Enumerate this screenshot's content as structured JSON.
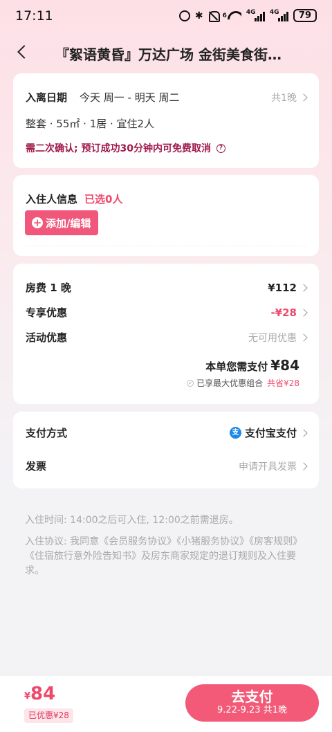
{
  "status_bar": {
    "time": "17:11",
    "battery": "79",
    "signal_label_1": "4G",
    "signal_label_2": "4G",
    "wifi_label": "6"
  },
  "header": {
    "title": "『絮语黄昏』万达广场 金街美食街…"
  },
  "stay": {
    "date_label": "入离日期",
    "dates": "今天 周一 - 明天 周二",
    "nights": "共1晚",
    "room_info": "整套 · 55㎡ · 1居 · 宜住2人",
    "confirm_notice": "需二次确认; 预订成功30分钟内可免费取消",
    "help_icon": "?"
  },
  "guests": {
    "label": "入住人信息",
    "selected": "已选0人",
    "add_button": "添加/编辑"
  },
  "pricing": {
    "room_fee_label": "房费 1 晚",
    "room_fee": "¥112",
    "discount_label": "专享优惠",
    "discount": "-¥28",
    "activity_label": "活动优惠",
    "activity_value": "无可用优惠",
    "total_label": "本单您需支付",
    "total": "¥84",
    "combo_text": "已享最大优惠组合",
    "combo_saved": "共省¥28"
  },
  "payment": {
    "method_label": "支付方式",
    "method": "支付宝支付",
    "alipay_icon_char": "支",
    "invoice_label": "发票",
    "invoice_action": "申请开具发票"
  },
  "notes": {
    "checkin_time": "入住时间: 14:00之后可入住, 12:00之前需退房。",
    "agreement": "入住协议: 我同意《会员服务协议》《小猪服务协议》《房客规则》《住宿旅行意外险告知书》及房东商家规定的退订规则及入住要求。"
  },
  "bottom_bar": {
    "currency": "¥",
    "price": "84",
    "saved_badge": "已优惠¥28",
    "pay_button": "去支付",
    "pay_button_sub": "9.22-9.23 共1晚"
  },
  "colors": {
    "accent": "#f25a78",
    "price_red": "#f0476a",
    "notice": "#a01a4b"
  }
}
